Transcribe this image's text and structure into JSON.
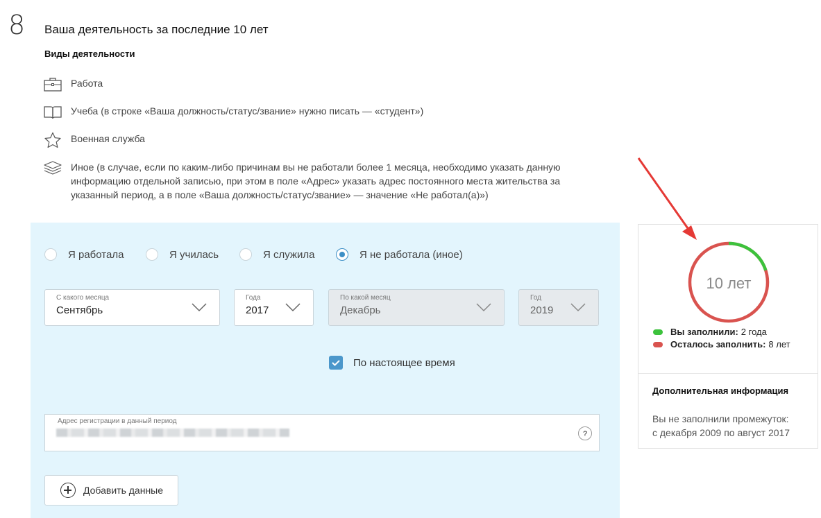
{
  "step_number": "8",
  "section_title": "Ваша деятельность за последние 10 лет",
  "types_heading": "Виды деятельности",
  "activity_types": [
    {
      "icon": "briefcase-icon",
      "text": "Работа"
    },
    {
      "icon": "book-icon",
      "text": "Учеба (в строке «Ваша должность/статус/звание» нужно писать — «студент»)"
    },
    {
      "icon": "star-icon",
      "text": "Военная служба"
    },
    {
      "icon": "layers-icon",
      "text": "Иное (в случае, если по каким-либо причинам вы не работали более 1 месяца, необходимо указать данную информацию отдельной записью, при этом в поле «Адрес» указать адрес постоянного места жительства за указанный период, а в поле «Ваша должность/статус/звание» — значение «Не работал(а)»)"
    }
  ],
  "radios": [
    {
      "label": "Я работала",
      "checked": false
    },
    {
      "label": "Я училась",
      "checked": false
    },
    {
      "label": "Я служила",
      "checked": false
    },
    {
      "label": "Я не работала (иное)",
      "checked": true
    }
  ],
  "selects": {
    "from_month": {
      "label": "С какого месяца",
      "value": "Сентябрь"
    },
    "from_year": {
      "label": "Года",
      "value": "2017"
    },
    "to_month": {
      "label": "По какой месяц",
      "value": "Декабрь",
      "disabled": true
    },
    "to_year": {
      "label": "Год",
      "value": "2019",
      "disabled": true
    }
  },
  "present_checkbox": {
    "label": "По настоящее время",
    "checked": true
  },
  "address": {
    "label": "Адрес регистрации в данный период",
    "help": "?"
  },
  "add_button": "Добавить данные",
  "progress": {
    "ring_label": "10 лет",
    "filled_fraction": 0.2,
    "filled_color": "#3cc23c",
    "remaining_color": "#d9534f",
    "filled_label": "Вы заполнили:",
    "filled_value": "2 года",
    "remaining_label": "Осталось заполнить:",
    "remaining_value": "8 лет"
  },
  "additional": {
    "title": "Дополнительная информация",
    "line1": "Вы не заполнили промежуток:",
    "line2": "с декабря 2009 по август 2017"
  }
}
